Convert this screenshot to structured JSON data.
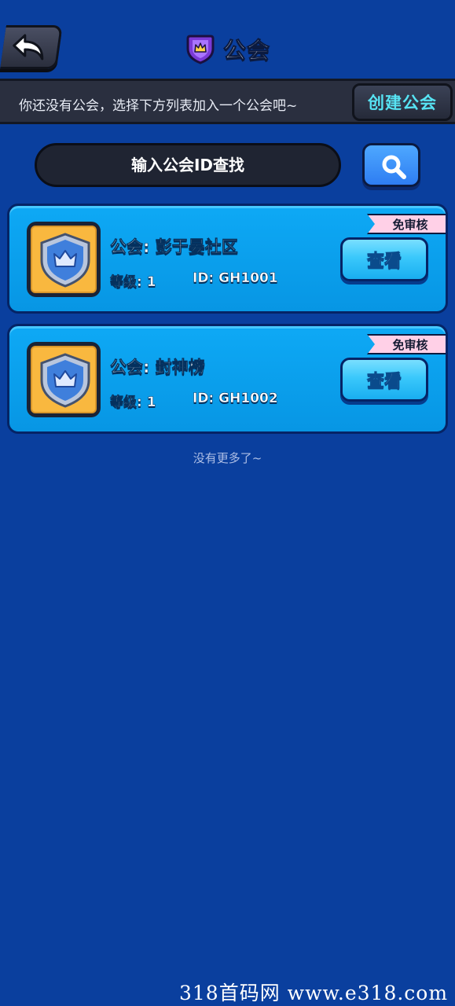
{
  "header": {
    "back_icon": "back-arrow-icon",
    "title": "公会",
    "title_icon": "guild-shield-icon"
  },
  "notice": {
    "text": "你还没有公会，选择下方列表加入一个公会吧~",
    "create_label": "创建公会"
  },
  "search": {
    "placeholder": "输入公会ID查找",
    "button_icon": "search-icon"
  },
  "guilds": [
    {
      "name": "公会: 彭于晏社区",
      "level": "等级: 1",
      "id": "ID: GH1001",
      "tag": "免审核",
      "view_label": "查看"
    },
    {
      "name": "公会: 封神榜",
      "level": "等级: 1",
      "id": "ID: GH1002",
      "tag": "免审核",
      "view_label": "查看"
    }
  ],
  "list_end_text": "没有更多了~",
  "watermark": "318首码网 www.e318.com",
  "colors": {
    "background": "#0a3f9e",
    "card": "#0ea9f5",
    "accent": "#57e3f3",
    "emblem": "#f9b83f",
    "tag": "#ffd0e7"
  }
}
